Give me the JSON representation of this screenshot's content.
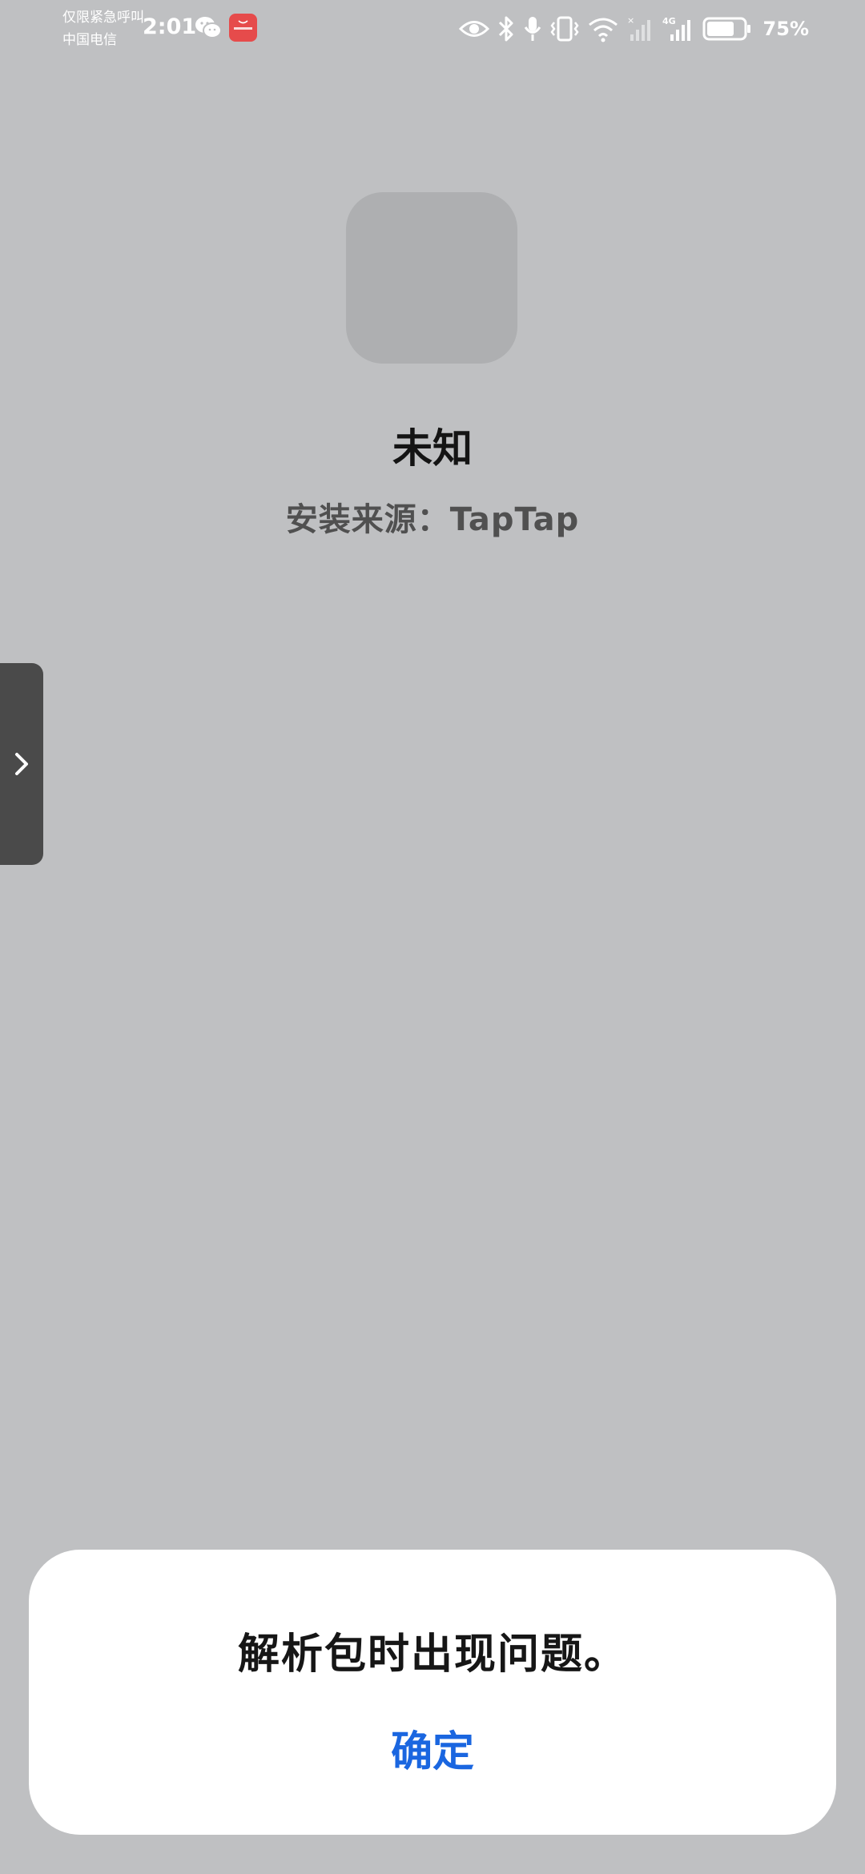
{
  "status_bar": {
    "emergency_text": "仅限紧急呼叫",
    "carrier": "中国电信",
    "time": "2:01",
    "battery_percent": "75%",
    "icons": [
      "wechat-icon",
      "huawei-appgallery-icon",
      "eye-icon",
      "bluetooth-icon",
      "microphone-icon",
      "vibrate-icon",
      "wifi-icon",
      "signal-icon",
      "signal-4g-icon",
      "battery-icon"
    ],
    "battery_level": 0.75
  },
  "app": {
    "name": "未知",
    "install_source": "安装来源：TapTap"
  },
  "dialog": {
    "message": "解析包时出现问题。",
    "confirm_label": "确定"
  },
  "colors": {
    "background": "#bfc0c2",
    "accent": "#1a66e0",
    "dialog_bg": "#ffffff"
  }
}
